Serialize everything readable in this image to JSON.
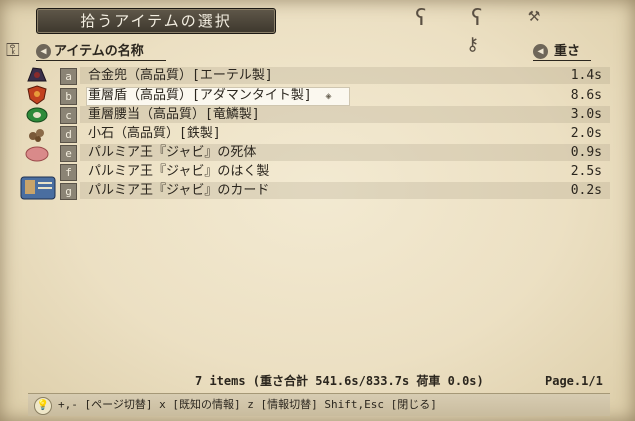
{
  "window": {
    "title": "拾うアイテムの選択"
  },
  "columns": {
    "name_header": "アイテムの名称",
    "weight_header": "重さ"
  },
  "items": [
    {
      "key": "a",
      "name": "合金兜（高品質）[エーテル製]",
      "weight": "1.4s",
      "icon": "helmet-icon",
      "selected": false
    },
    {
      "key": "b",
      "name": "重層盾（高品質）[アダマンタイト製]",
      "weight": "8.6s",
      "icon": "shield-icon",
      "selected": true,
      "indicator": "◈"
    },
    {
      "key": "c",
      "name": "重層腰当（高品質）[竜鱗製]",
      "weight": "3.0s",
      "icon": "belt-icon",
      "selected": false
    },
    {
      "key": "d",
      "name": "小石（高品質）[鉄製]",
      "weight": "2.0s",
      "icon": "stones-icon",
      "selected": false
    },
    {
      "key": "e",
      "name": "パルミア王『ジャビ』の死体",
      "weight": "0.9s",
      "icon": "meat-icon",
      "selected": false
    },
    {
      "key": "f",
      "name": "パルミア王『ジャビ』のはく製",
      "weight": "2.5s",
      "icon": "none",
      "selected": false
    },
    {
      "key": "g",
      "name": "パルミア王『ジャビ』のカード",
      "weight": "0.2s",
      "icon": "card-icon",
      "selected": false
    }
  ],
  "footer": {
    "status": "7 items  (重さ合計 541.6s/833.7s  荷車 0.0s)",
    "page": "Page.1/1"
  },
  "help": {
    "text": "+,- [ページ切替]  x [既知の情報]  z [情報切替]  Shift,Esc [閉じる]"
  }
}
